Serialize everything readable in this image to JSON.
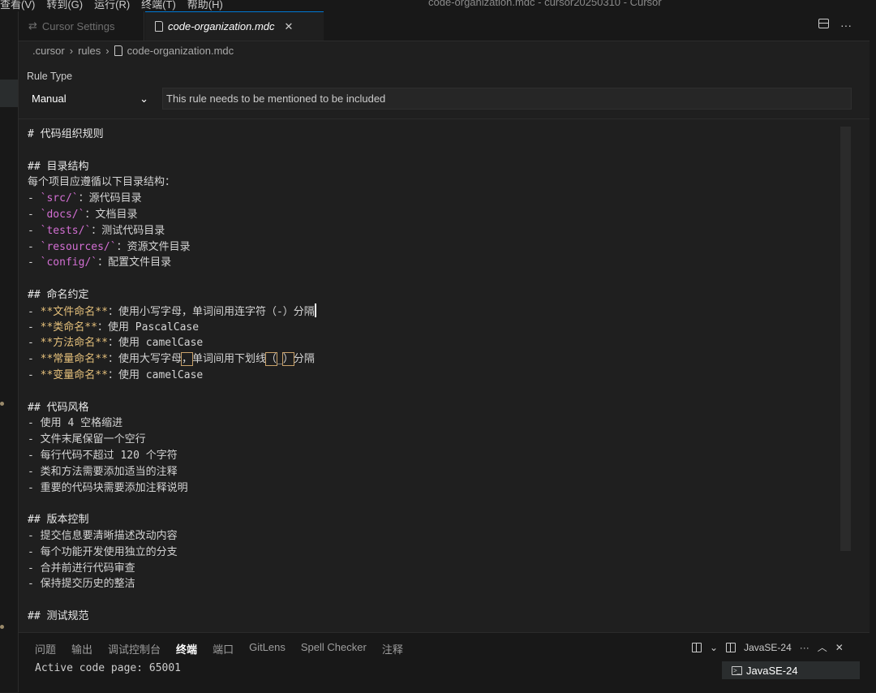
{
  "titlebar": {
    "menu": [
      "查看(V)",
      "转到(G)",
      "运行(R)",
      "终端(T)",
      "帮助(H)"
    ],
    "window_title": "code-organization.mdc - cursor20250310 - Cursor"
  },
  "tabs": [
    {
      "label": "Cursor Settings",
      "icon": "settings-icon"
    },
    {
      "label": "code-organization.mdc",
      "icon": "file-icon"
    }
  ],
  "breadcrumb": [
    ".cursor",
    "rules",
    "code-organization.mdc"
  ],
  "rule_type": {
    "label": "Rule Type",
    "selected": "Manual",
    "description": "This rule needs to be mentioned to be included"
  },
  "editor": {
    "l01": "# 代码组织规则",
    "l03": "## 目录结构",
    "l04": "每个项目应遵循以下目录结构：",
    "list_prefix": "- ",
    "dir_items": [
      {
        "code": "`src/`",
        "text": "：源代码目录"
      },
      {
        "code": "`docs/`",
        "text": "：文档目录"
      },
      {
        "code": "`tests/`",
        "text": "：测试代码目录"
      },
      {
        "code": "`resources/`",
        "text": "：资源文件目录"
      },
      {
        "code": "`config/`",
        "text": "：配置文件目录"
      }
    ],
    "l11": "## 命名约定",
    "naming": [
      {
        "bold": "**文件命名**",
        "text": "：使用小写字母，单词间用连字符（-）分隔"
      },
      {
        "bold": "**类命名**",
        "text": "：使用 PascalCase"
      },
      {
        "bold": "**方法命名**",
        "text": "：使用 camelCase"
      },
      {
        "bold": "**常量命名**",
        "text_a": "：使用大写字母",
        "hl1": "，",
        "text_b": "单词间用下划线",
        "hl2": "（",
        "hl3": "_",
        "hl4": "）",
        "text_c": "分隔"
      },
      {
        "bold": "**变量命名**",
        "text": "：使用 camelCase"
      }
    ],
    "l18": "## 代码风格",
    "style": [
      "- 使用 4 空格缩进",
      "- 文件末尾保留一个空行",
      "- 每行代码不超过 120 个字符",
      "- 类和方法需要添加适当的注释",
      "- 重要的代码块需要添加注释说明"
    ],
    "l25": "## 版本控制",
    "vcs": [
      "- 提交信息要清晰描述改动内容",
      "- 每个功能开发使用独立的分支",
      "- 合并前进行代码审查",
      "- 保持提交历史的整洁"
    ],
    "l31": "## 测试规范"
  },
  "panel": {
    "tabs": [
      "问题",
      "输出",
      "调试控制台",
      "终端",
      "端口",
      "GitLens",
      "Spell Checker",
      "注释"
    ],
    "active_tab": "终端",
    "terminal_name": "JavaSE-24",
    "terminal_output": "Active code page: 65001",
    "terminal_list_item": "JavaSE-24"
  }
}
